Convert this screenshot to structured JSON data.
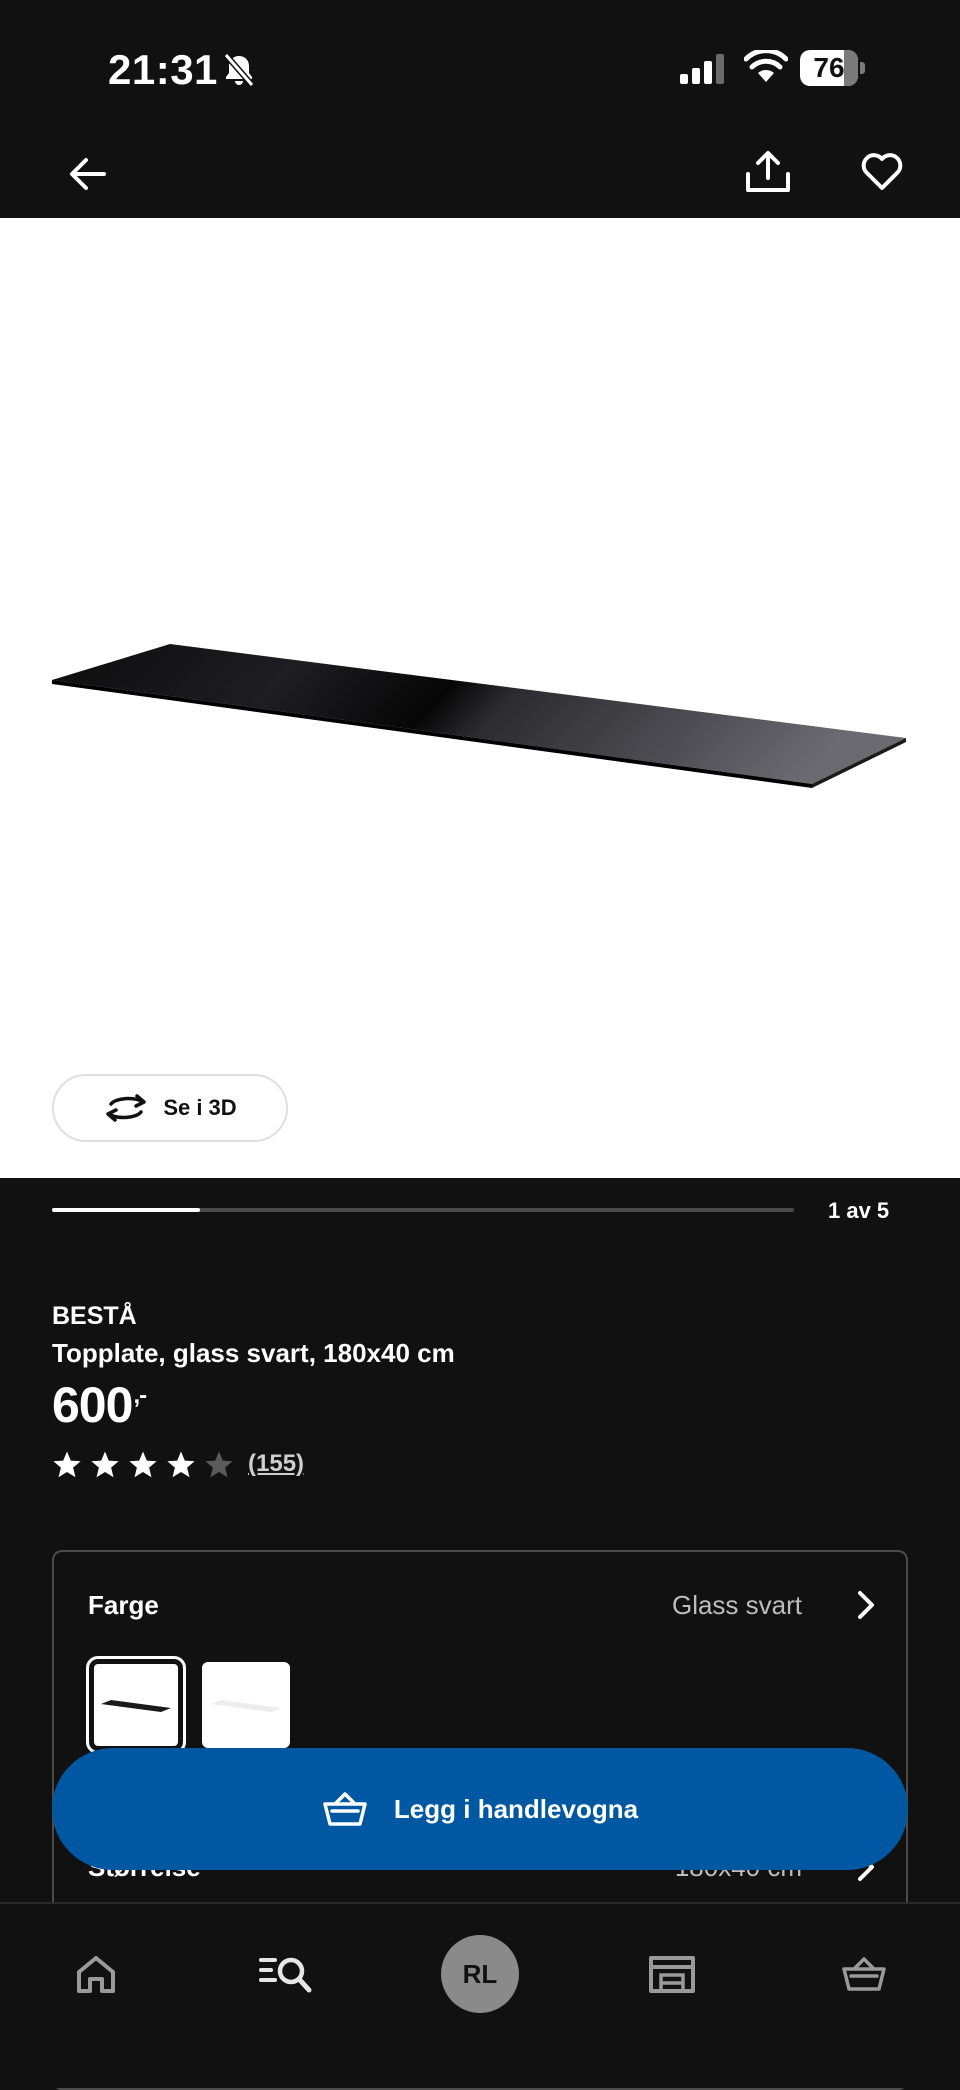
{
  "status_bar": {
    "time": "21:31",
    "battery_level": "76"
  },
  "gallery": {
    "view_3d_label": "Se i 3D",
    "position_label": "1 av 5",
    "current_index": 1,
    "total": 5
  },
  "product": {
    "brand": "BESTÅ",
    "description": "Topplate, glass svart, 180x40 cm",
    "price": "600",
    "price_suffix": ",-",
    "rating": 4,
    "rating_max": 5,
    "review_count": "(155)"
  },
  "options": {
    "color_label": "Farge",
    "color_value": "Glass svart",
    "size_label": "Størrelse",
    "size_value": "180x40 cm"
  },
  "cart_button": {
    "label": "Legg i handlevogna"
  },
  "tab_bar": {
    "avatar_initials": "RL"
  },
  "colors": {
    "background": "#111111",
    "accent_blue": "#0058a3",
    "star_filled": "#ffffff",
    "star_empty": "#5a5a5a"
  }
}
